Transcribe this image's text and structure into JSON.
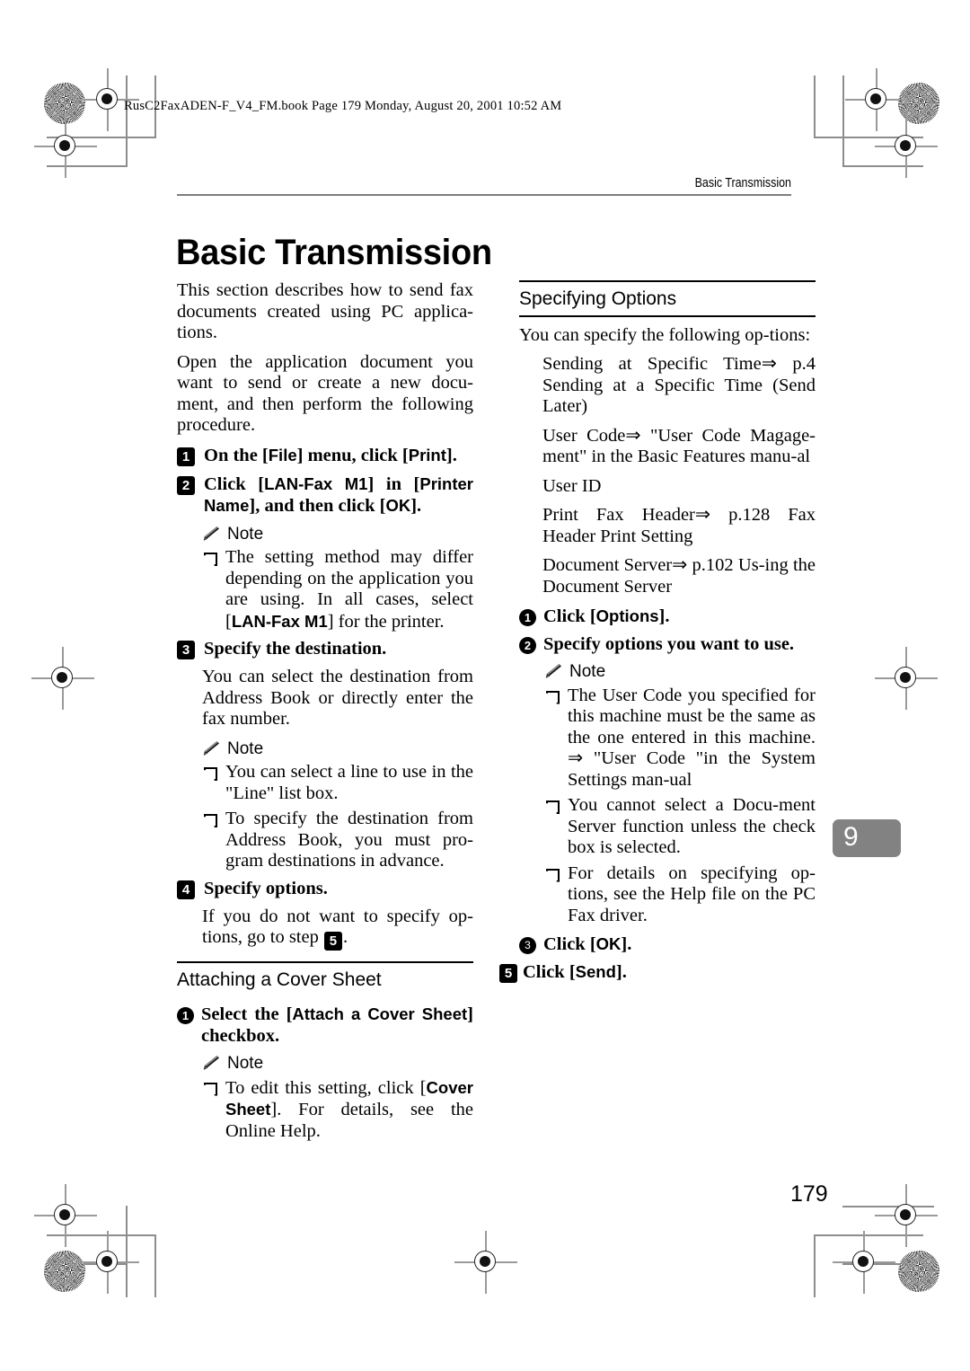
{
  "book_header": "RusC2FaxADEN-F_V4_FM.book  Page 179  Monday, August 20, 2001  10:52 AM",
  "running_head": "Basic Transmission",
  "page_title": "Basic Transmission",
  "folio": "179",
  "chapter_tab": "9",
  "colors": {
    "chapter_tab_bg": "#828282",
    "rule": "#000000",
    "running_head_rule": "#7d7d7d"
  },
  "left_column": {
    "intro_1": "This section describes how to send fax documents created using PC applica-tions.",
    "intro_2": "Open the application document you want to send or create a new docu-ment, and then perform the following procedure.",
    "step1": {
      "num": "1",
      "text_before": "On the [",
      "key1": "File",
      "text_mid": "] menu, click [",
      "key2": "Print",
      "text_after": "]."
    },
    "step2": {
      "num": "2",
      "text_before": "Click [",
      "key1": "LAN-Fax M1",
      "text_mid": "] in [",
      "key2": "Printer Name",
      "text_after": "], and then click [",
      "key3": "OK",
      "text_end": "]."
    },
    "note_label_1": "Note",
    "note1_item1_before": "The setting method may differ depending on the application you are using. In all cases, select [",
    "note1_item1_key": "LAN-Fax M1",
    "note1_item1_after": "] for the printer.",
    "step3": {
      "num": "3",
      "text": "Specify the destination."
    },
    "step3_body": "You can select the destination from Address Book or directly enter the fax number.",
    "note_label_2": "Note",
    "note2_item1": "You can select a line to use in the \"Line\" list box.",
    "note2_item2": "To specify the destination from Address Book, you must pro-gram destinations in advance.",
    "step4": {
      "num": "4",
      "text": "Specify options."
    },
    "step4_body_before": "If you do not want to specify op-tions, go to step ",
    "step4_body_badge": "5",
    "step4_body_after": ".",
    "subsection_heading": "Attaching a Cover Sheet",
    "substep1": {
      "num": "1",
      "text_before": "Select the [",
      "key1": "Attach a Cover Sheet",
      "text_after": "] checkbox."
    },
    "note_label_3": "Note",
    "note3_item1_before": "To edit this setting, click [",
    "note3_item1_key": "Cover Sheet",
    "note3_item1_after": "]. For details, see the Online Help."
  },
  "right_column": {
    "section_heading": "Specifying Options",
    "intro": "You can specify the following op-tions:",
    "options": [
      "Sending at Specific Time⇒ p.4  Sending at a Specific Time (Send Later)",
      "User Code⇒ \"User Code Magage-ment\" in the Basic Features manu-al",
      "User ID",
      "Print Fax Header⇒ p.128   Fax Header Print Setting",
      "Document Server⇒ p.102   Us-ing the Document Server"
    ],
    "substep1": {
      "num": "1",
      "text_before": "Click [",
      "key1": "Options",
      "text_after": "]."
    },
    "substep2": {
      "num": "2",
      "text": "Specify options you want to use."
    },
    "note_label": "Note",
    "note_items": [
      "The User Code you specified for this machine must be the same as the one entered in this machine. ⇒ \"User Code \"in the System Settings man-ual",
      "You cannot select a Docu-ment Server function unless the check box is selected.",
      "For details on specifying op-tions, see the Help file on the PC Fax driver."
    ],
    "substep3": {
      "num": "3",
      "text_before": "Click [",
      "key1": "OK",
      "text_after": "]."
    },
    "step5": {
      "num": "5",
      "text_before": "Click [",
      "key1": "Send",
      "text_after": "]."
    }
  }
}
